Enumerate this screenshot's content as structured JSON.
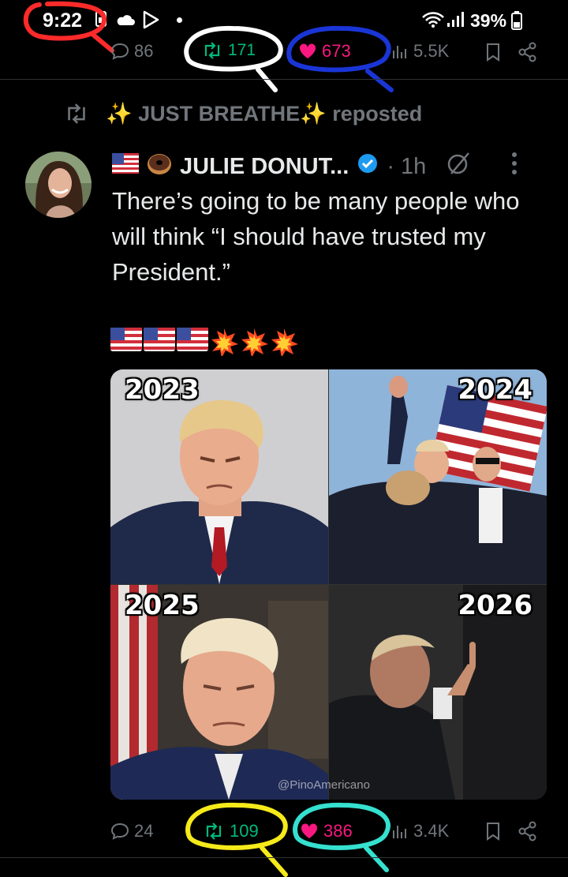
{
  "status_bar": {
    "time": "9:22",
    "battery": "39%"
  },
  "top_actions": {
    "replies": "86",
    "reposts": "171",
    "likes": "673",
    "views": "5.5K"
  },
  "repost_context": {
    "label": "✨ JUST BREATHE✨ reposted"
  },
  "tweet": {
    "author_name": "JULIE DONUT...",
    "time": "· 1h",
    "text": "There’s going to be many people who will think “I should have trusted my President.”",
    "media": {
      "panels": [
        {
          "year": "2023"
        },
        {
          "year": "2024"
        },
        {
          "year": "2025"
        },
        {
          "year": "2026"
        }
      ],
      "watermark": "@PinoAmericano"
    }
  },
  "bottom_actions": {
    "replies": "24",
    "reposts": "109",
    "likes": "386",
    "views": "3.4K"
  },
  "colors": {
    "background": "#000000",
    "text": "#e7e9ea",
    "muted": "#71767b",
    "repost_green": "#00ba7c",
    "like_pink": "#f91880",
    "verified_blue": "#1d9bf0",
    "annotation_red": "#ff2a2a",
    "annotation_white": "#ffffff",
    "annotation_blue": "#1a35d6",
    "annotation_yellow": "#f5ea1a",
    "annotation_cyan": "#35e0cf"
  }
}
